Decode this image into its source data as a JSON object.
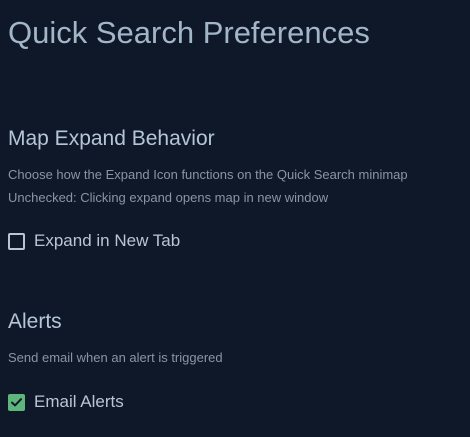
{
  "page": {
    "title": "Quick Search Preferences"
  },
  "map_expand": {
    "heading": "Map Expand Behavior",
    "description_1": "Choose how the Expand Icon functions on the Quick Search minimap",
    "description_2": "Unchecked: Clicking expand opens map in new window",
    "checkbox_label": "Expand in New Tab",
    "checked": false
  },
  "alerts": {
    "heading": "Alerts",
    "description": "Send email when an alert is triggered",
    "checkbox_label": "Email Alerts",
    "checked": true
  },
  "icons": {
    "checked_mark": "check-icon"
  },
  "colors": {
    "background": "#0f1829",
    "check_green": "#5fb67c"
  }
}
